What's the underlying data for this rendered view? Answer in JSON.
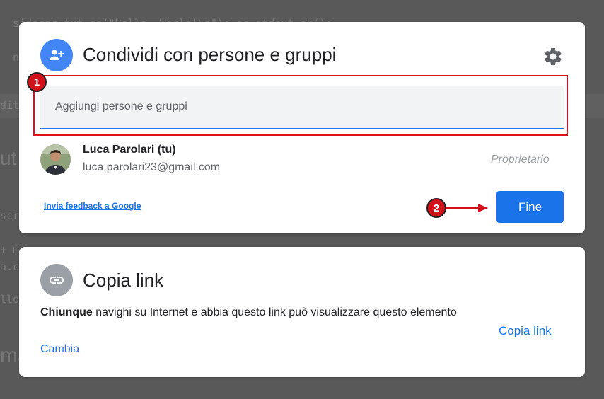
{
  "background": {
    "code_lines": [
      "sidecar.txt.ce(\"Hello, World!\\n\"); sc.stdout.ok();",
      "n",
      "diti",
      "ut",
      "scri",
      "+ m",
      "a.c",
      "llo",
      "ma"
    ]
  },
  "share_dialog": {
    "title": "Condividi con persone e gruppi",
    "add_icon": "person-add-icon",
    "settings_icon": "gear-icon",
    "input_placeholder": "Aggiungi persone e gruppi",
    "user": {
      "name": "Luca Parolari (tu)",
      "email": "luca.parolari23@gmail.com",
      "role": "Proprietario"
    },
    "feedback_link": "Invia feedback a Google",
    "done_label": "Fine"
  },
  "link_dialog": {
    "title": "Copia link",
    "link_icon": "link-icon",
    "desc_bold": "Chiunque",
    "desc_rest": " navighi su Internet e abbia questo link può visualizzare questo elemento",
    "change_label": "Cambia",
    "copy_label": "Copia link"
  },
  "annotations": {
    "step1": "1",
    "step2": "2"
  },
  "colors": {
    "accent": "#1a73e8",
    "annotation_red": "#d3111b",
    "overlay": "#595959"
  }
}
